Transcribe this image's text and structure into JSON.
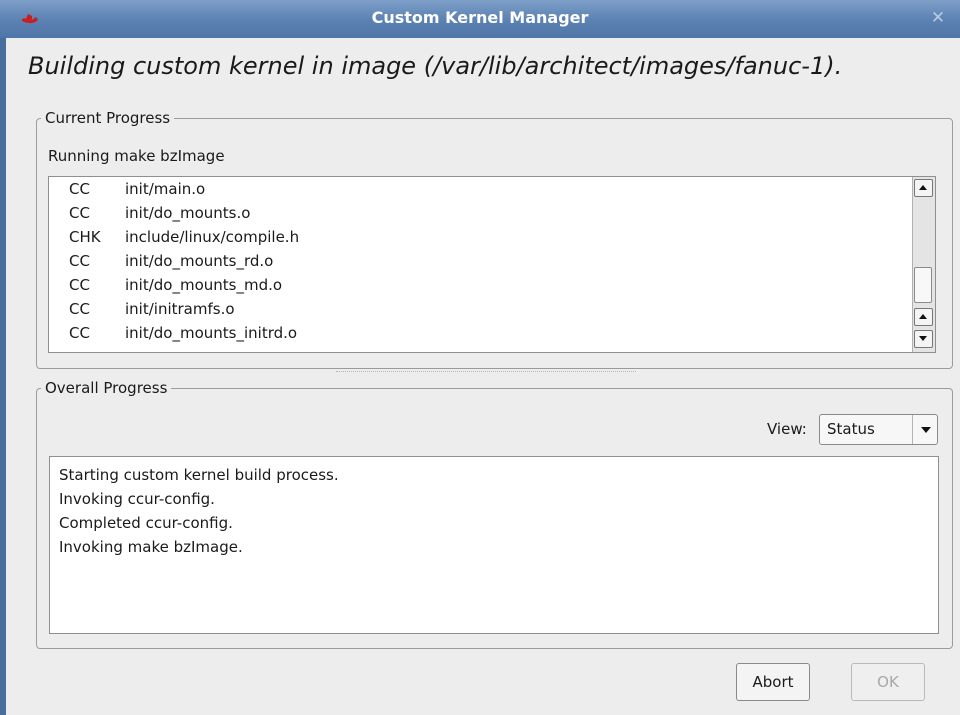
{
  "window": {
    "title": "Custom Kernel Manager"
  },
  "heading": "Building custom kernel in image (/var/lib/architect/images/fanuc-1).",
  "current_progress": {
    "legend": "Current Progress",
    "running": "Running make bzImage",
    "log": [
      {
        "code": "CC",
        "path": "init/main.o"
      },
      {
        "code": "CC",
        "path": "init/do_mounts.o"
      },
      {
        "code": "CHK",
        "path": "include/linux/compile.h"
      },
      {
        "code": "CC",
        "path": "init/do_mounts_rd.o"
      },
      {
        "code": "CC",
        "path": "init/do_mounts_md.o"
      },
      {
        "code": "CC",
        "path": "init/initramfs.o"
      },
      {
        "code": "CC",
        "path": "init/do_mounts_initrd.o"
      }
    ]
  },
  "overall_progress": {
    "legend": "Overall Progress",
    "view_label": "View:",
    "view_value": "Status",
    "status_lines": [
      "Starting custom kernel build process.",
      "Invoking ccur-config.",
      "Completed ccur-config.",
      "Invoking make bzImage."
    ]
  },
  "buttons": {
    "abort": "Abort",
    "ok": "OK"
  }
}
